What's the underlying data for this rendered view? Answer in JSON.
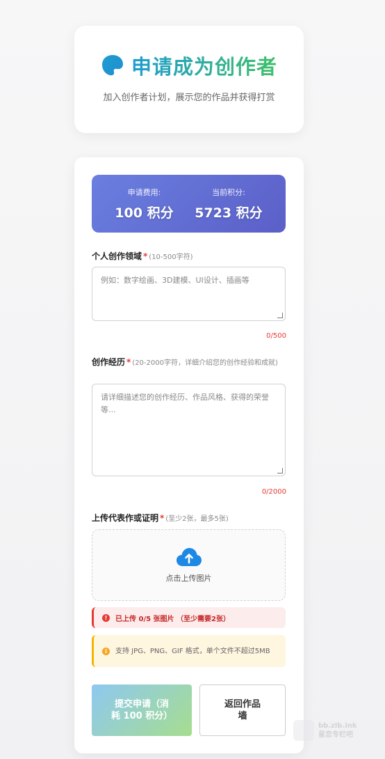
{
  "header": {
    "title": "申请成为创作者",
    "subtitle": "加入创作者计划，展示您的作品并获得打赏"
  },
  "points": {
    "fee_label": "申请费用:",
    "fee_value": "100 积分",
    "current_label": "当前积分:",
    "current_value": "5723 积分"
  },
  "field_domain": {
    "label": "个人创作领域",
    "required": "*",
    "hint": "(10-500字符)",
    "placeholder": "例如：数字绘画、3D建模、UI设计、插画等",
    "counter": "0/500"
  },
  "field_experience": {
    "label": "创作经历",
    "required": "*",
    "hint": "(20-2000字符，详细介绍您的创作经验和成就)",
    "placeholder": "请详细描述您的创作经历、作品风格、获得的荣誉等...",
    "counter": "0/2000"
  },
  "field_upload": {
    "label": "上传代表作或证明",
    "required": "*",
    "hint": "(至少2张，最多5张)",
    "upload_text": "点击上传图片"
  },
  "alerts": {
    "error": "已上传 0/5 张图片 （至少需要2张）",
    "warning": "支持 JPG、PNG、GIF 格式，单个文件不超过5MB"
  },
  "buttons": {
    "submit": "提交申请（消耗 100 积分）",
    "back": "返回作品墙"
  },
  "watermark": {
    "line1": "bb.zlb.ink",
    "line2": "星恋专栏吧"
  },
  "colors": {
    "accent_blue": "#1f9cd1",
    "accent_green": "#3fbf6a",
    "points_bg": "#5b5fc7",
    "error": "#e53935",
    "warning": "#f5b400"
  }
}
